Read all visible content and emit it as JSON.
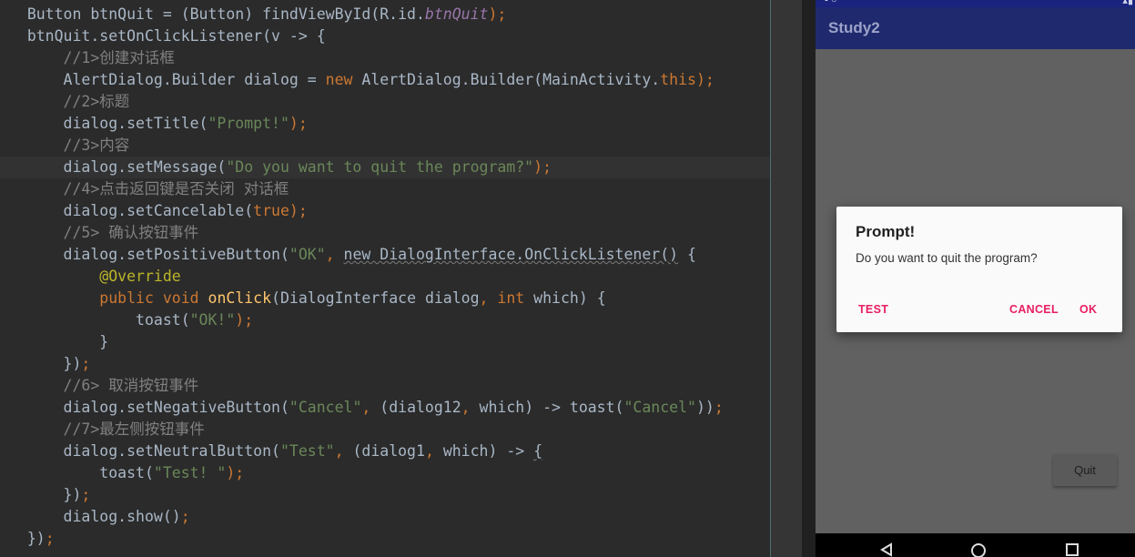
{
  "editor": {
    "lines": [
      [
        [
          "Button btnQuit = (Button) findViewById(R.id.",
          ""
        ],
        [
          "btnQuit",
          "it"
        ],
        [
          ");",
          "kw"
        ]
      ],
      [
        [
          "btnQuit.setOnClickListener(v -> {",
          ""
        ]
      ],
      [
        [
          "    //1>创建对话框",
          "cm"
        ]
      ],
      [
        [
          "    AlertDialog.Builder dialog = ",
          ""
        ],
        [
          "new",
          "kw"
        ],
        [
          " AlertDialog.Builder(MainActivity.",
          ""
        ],
        [
          "this",
          "kw"
        ],
        [
          ");",
          "kw"
        ]
      ],
      [
        [
          "    //2>标题",
          "cm"
        ]
      ],
      [
        [
          "    dialog.setTitle(",
          ""
        ],
        [
          "\"Prompt!\"",
          "str"
        ],
        [
          ");",
          "kw"
        ]
      ],
      [
        [
          "    //3>内容",
          "cm"
        ]
      ],
      [
        [
          "    dialog.setMessage(",
          ""
        ],
        [
          "\"Do you want to quit the program?\"",
          "str"
        ],
        [
          ");",
          "kw"
        ]
      ],
      [
        [
          "    //4>点击返回键是否关闭 对话框",
          "cm"
        ]
      ],
      [
        [
          "    dialog.setCancelable(",
          ""
        ],
        [
          "true",
          "kw"
        ],
        [
          ");",
          "kw"
        ]
      ],
      [
        [
          "    //5> 确认按钮事件",
          "cm"
        ]
      ],
      [
        [
          "    dialog.setPositiveButton(",
          ""
        ],
        [
          "\"OK\"",
          "str"
        ],
        [
          ", ",
          "kw"
        ],
        [
          "new DialogInterface.OnClickListener()",
          "sq"
        ],
        [
          " {",
          ""
        ]
      ],
      [
        [
          "        ",
          ""
        ],
        [
          "@Override",
          "ann"
        ]
      ],
      [
        [
          "        ",
          ""
        ],
        [
          "public void ",
          "kw"
        ],
        [
          "onClick",
          "fn"
        ],
        [
          "(DialogInterface dialog",
          ""
        ],
        [
          ", ",
          "kw"
        ],
        [
          "int",
          "kw"
        ],
        [
          " which) {",
          ""
        ]
      ],
      [
        [
          "            toast(",
          ""
        ],
        [
          "\"OK!\"",
          "str"
        ],
        [
          ");",
          "kw"
        ]
      ],
      [
        [
          "        }",
          ""
        ]
      ],
      [
        [
          "    })",
          ""
        ],
        [
          ";",
          "kw"
        ]
      ],
      [
        [
          "    //6> 取消按钮事件",
          "cm"
        ]
      ],
      [
        [
          "    dialog.setNegativeButton(",
          ""
        ],
        [
          "\"Cancel\"",
          "str"
        ],
        [
          ", ",
          "kw"
        ],
        [
          "(dialog12",
          ""
        ],
        [
          ", ",
          "kw"
        ],
        [
          "which) -> toast(",
          ""
        ],
        [
          "\"Cancel\"",
          "str"
        ],
        [
          "))",
          ""
        ],
        [
          ";",
          "kw"
        ]
      ],
      [
        [
          "    //7>最左侧按钮事件",
          "cm"
        ]
      ],
      [
        [
          "    dialog.setNeutralButton(",
          ""
        ],
        [
          "\"Test\"",
          "str"
        ],
        [
          ", ",
          "kw"
        ],
        [
          "(dialog1",
          ""
        ],
        [
          ", ",
          "kw"
        ],
        [
          "which) -> ",
          ""
        ],
        [
          "{",
          "sq"
        ]
      ],
      [
        [
          "        toast(",
          ""
        ],
        [
          "\"Test! \"",
          "str"
        ],
        [
          ");",
          "kw"
        ]
      ],
      [
        [
          "    })",
          ""
        ],
        [
          ";",
          "kw"
        ]
      ],
      [
        [
          "    dialog.show()",
          ""
        ],
        [
          ";",
          "kw"
        ]
      ],
      [
        [
          "})",
          ""
        ],
        [
          ";",
          "kw"
        ]
      ]
    ],
    "highlight_line": 7
  },
  "device": {
    "app_title": "Study2",
    "quit_button": "Quit",
    "dialog": {
      "title": "Prompt!",
      "message": "Do you want to quit the program?",
      "neutral": "TEST",
      "negative": "CANCEL",
      "positive": "OK"
    },
    "accent_color": "#e91e63",
    "appbar_color": "#1f2a6e"
  },
  "icons": [
    "back-icon",
    "home-icon",
    "recents-icon"
  ]
}
